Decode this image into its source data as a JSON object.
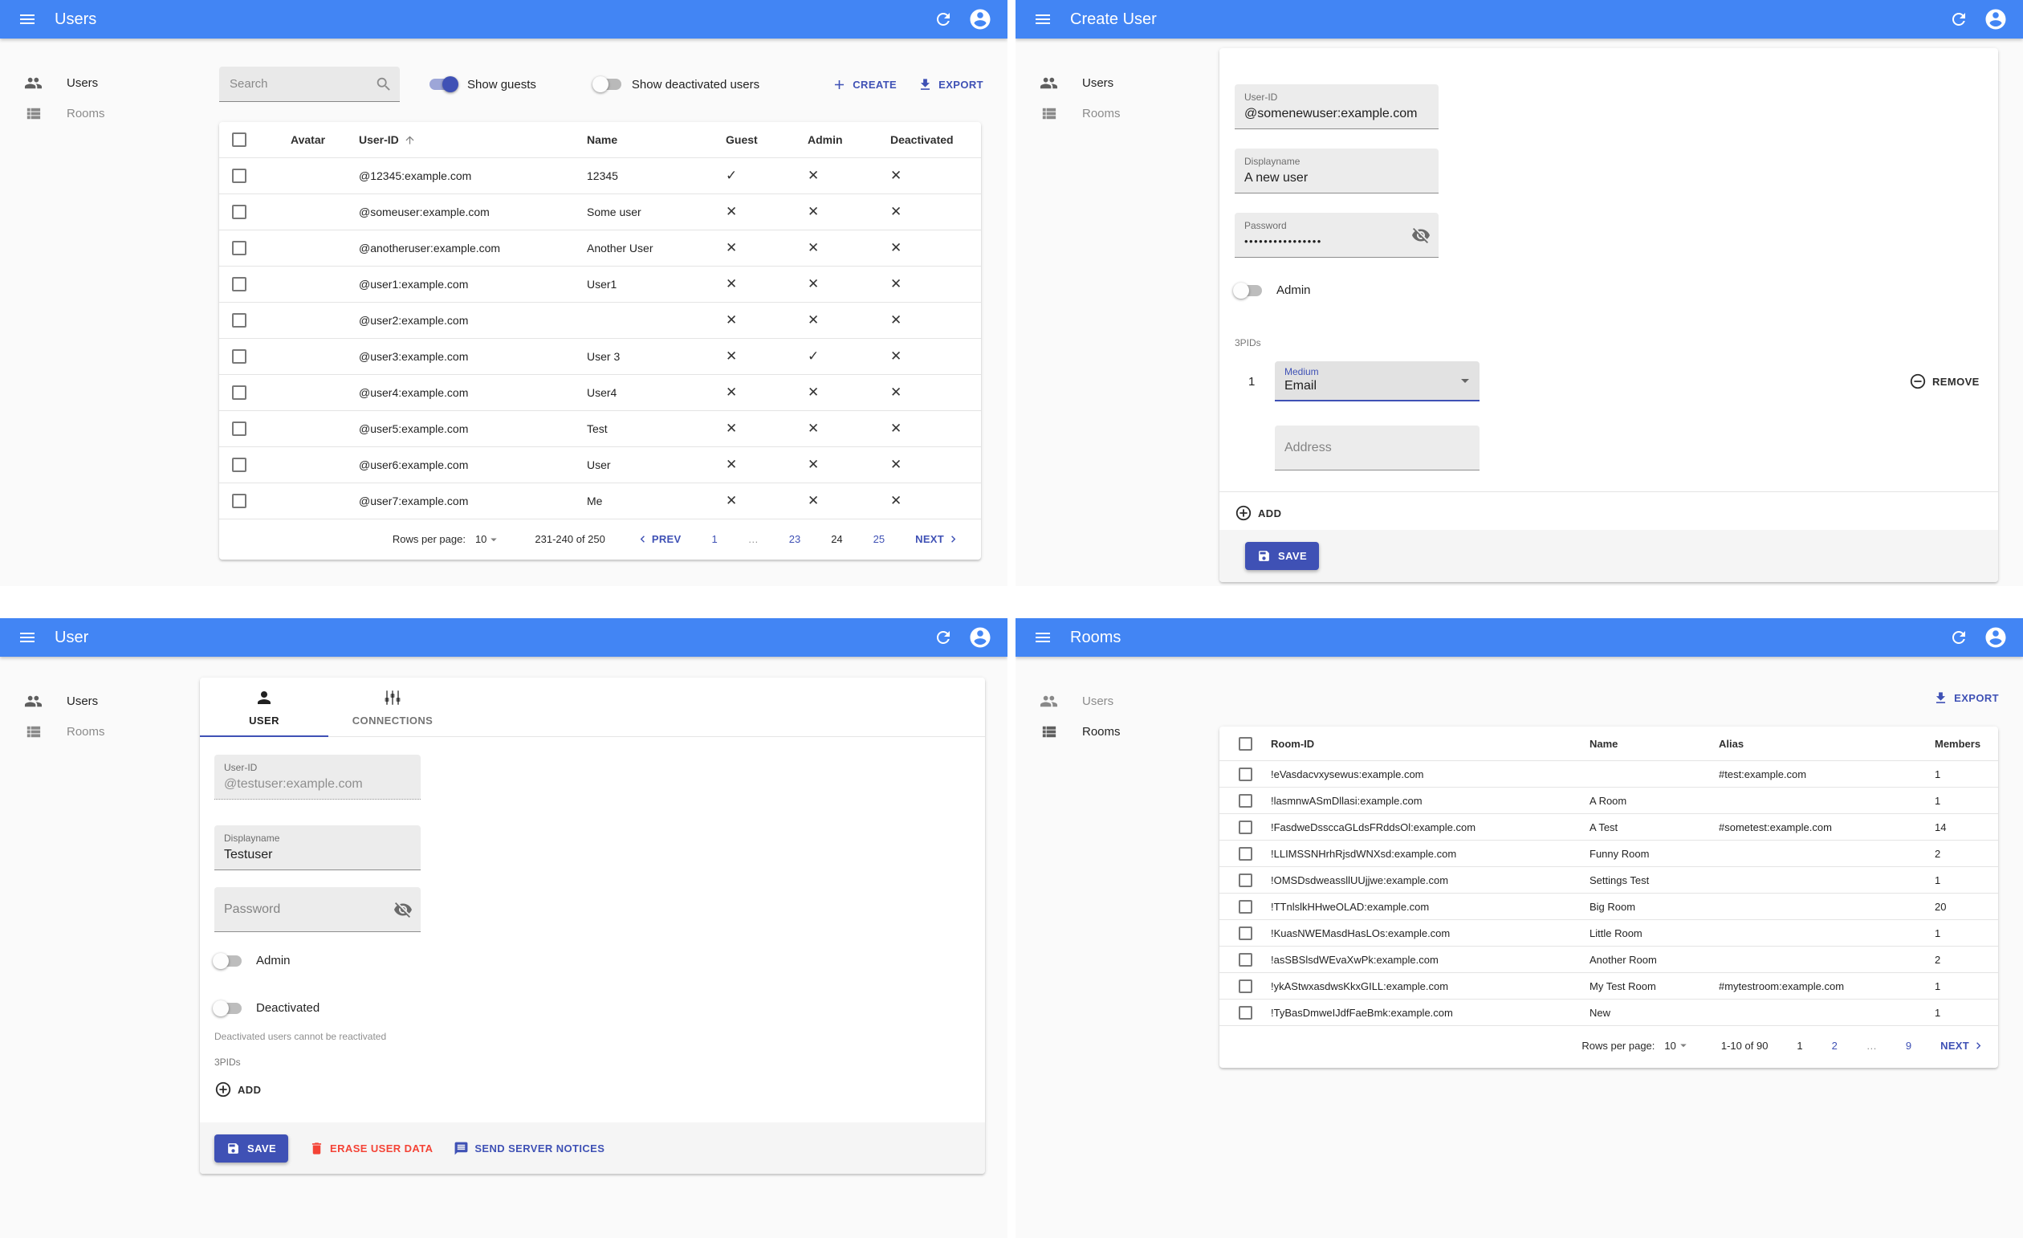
{
  "colors": {
    "appbar": "#4285f4",
    "primary": "#3f51b5",
    "danger": "#f44336",
    "page": "#fafafa",
    "card": "#ffffff"
  },
  "menu": {
    "users": "Users",
    "rooms": "Rooms"
  },
  "users_list": {
    "title": "Users",
    "search_placeholder": "Search",
    "show_guests_label": "Show guests",
    "show_deactivated_label": "Show deactivated users",
    "create_label": "CREATE",
    "export_label": "EXPORT",
    "headers": {
      "avatar": "Avatar",
      "user_id": "User-ID",
      "name": "Name",
      "guest": "Guest",
      "admin": "Admin",
      "deactivated": "Deactivated"
    },
    "rows": [
      {
        "user_id": "@12345:example.com",
        "name": "12345",
        "guest": "✓",
        "admin": "✕",
        "deactivated": "✕"
      },
      {
        "user_id": "@someuser:example.com",
        "name": "Some user",
        "guest": "✕",
        "admin": "✕",
        "deactivated": "✕"
      },
      {
        "user_id": "@anotheruser:example.com",
        "name": "Another User",
        "guest": "✕",
        "admin": "✕",
        "deactivated": "✕"
      },
      {
        "user_id": "@user1:example.com",
        "name": "User1",
        "guest": "✕",
        "admin": "✕",
        "deactivated": "✕"
      },
      {
        "user_id": "@user2:example.com",
        "name": "",
        "guest": "✕",
        "admin": "✕",
        "deactivated": "✕"
      },
      {
        "user_id": "@user3:example.com",
        "name": "User 3",
        "guest": "✕",
        "admin": "✓",
        "deactivated": "✕"
      },
      {
        "user_id": "@user4:example.com",
        "name": "User4",
        "guest": "✕",
        "admin": "✕",
        "deactivated": "✕"
      },
      {
        "user_id": "@user5:example.com",
        "name": "Test",
        "guest": "✕",
        "admin": "✕",
        "deactivated": "✕"
      },
      {
        "user_id": "@user6:example.com",
        "name": "User",
        "guest": "✕",
        "admin": "✕",
        "deactivated": "✕"
      },
      {
        "user_id": "@user7:example.com",
        "name": "Me",
        "guest": "✕",
        "admin": "✕",
        "deactivated": "✕"
      }
    ],
    "pagination": {
      "rows_per_page_label": "Rows per page:",
      "rows_per_page": "10",
      "range": "231-240 of 250",
      "prev": "PREV",
      "next": "NEXT",
      "pages": [
        "1",
        "…",
        "23",
        "24",
        "25"
      ]
    }
  },
  "create_user": {
    "title": "Create User",
    "user_id": {
      "label": "User-ID",
      "value": "@somenewuser:example.com"
    },
    "displayname": {
      "label": "Displayname",
      "value": "A new user"
    },
    "password": {
      "label": "Password",
      "value": "••••••••••••••••"
    },
    "admin_label": "Admin",
    "threepids_label": "3PIDs",
    "row_index": "1",
    "medium": {
      "label": "Medium",
      "value": "Email"
    },
    "remove_label": "REMOVE",
    "address_placeholder": "Address",
    "add_label": "ADD",
    "save_label": "SAVE"
  },
  "user_edit": {
    "title": "User",
    "tabs": {
      "user": "USER",
      "connections": "CONNECTIONS"
    },
    "user_id": {
      "label": "User-ID",
      "value": "@testuser:example.com"
    },
    "displayname": {
      "label": "Displayname",
      "value": "Testuser"
    },
    "password_placeholder": "Password",
    "admin_label": "Admin",
    "deactivated_label": "Deactivated",
    "deactivated_helper": "Deactivated users cannot be reactivated",
    "threepids_label": "3PIDs",
    "add_label": "ADD",
    "save_label": "SAVE",
    "erase_label": "ERASE USER DATA",
    "notices_label": "SEND SERVER NOTICES"
  },
  "rooms_list": {
    "title": "Rooms",
    "export_label": "EXPORT",
    "headers": {
      "room_id": "Room-ID",
      "name": "Name",
      "alias": "Alias",
      "members": "Members"
    },
    "rows": [
      {
        "room_id": "!eVasdacvxysewus:example.com",
        "name": "",
        "alias": "#test:example.com",
        "members": "1"
      },
      {
        "room_id": "!lasmnwASmDllasi:example.com",
        "name": "A Room",
        "alias": "",
        "members": "1"
      },
      {
        "room_id": "!FasdweDssccaGLdsFRddsOl:example.com",
        "name": "A Test",
        "alias": "#sometest:example.com",
        "members": "14"
      },
      {
        "room_id": "!LLIMSSNHrhRjsdWNXsd:example.com",
        "name": "Funny Room",
        "alias": "",
        "members": "2"
      },
      {
        "room_id": "!OMSDsdweassllUUjjwe:example.com",
        "name": "Settings Test",
        "alias": "",
        "members": "1"
      },
      {
        "room_id": "!TTnlslkHHweOLAD:example.com",
        "name": "Big Room",
        "alias": "",
        "members": "20"
      },
      {
        "room_id": "!KuasNWEMasdHasLOs:example.com",
        "name": "Little Room",
        "alias": "",
        "members": "1"
      },
      {
        "room_id": "!asSBSlsdWEvaXwPk:example.com",
        "name": "Another Room",
        "alias": "",
        "members": "2"
      },
      {
        "room_id": "!ykAStwxasdwsKkxGILL:example.com",
        "name": "My Test Room",
        "alias": "#mytestroom:example.com",
        "members": "1"
      },
      {
        "room_id": "!TyBasDmweIJdfFaeBmk:example.com",
        "name": "New",
        "alias": "",
        "members": "1"
      }
    ],
    "pagination": {
      "rows_per_page_label": "Rows per page:",
      "rows_per_page": "10",
      "range": "1-10 of 90",
      "next": "NEXT",
      "pages": [
        "1",
        "2",
        "…",
        "9"
      ]
    }
  }
}
